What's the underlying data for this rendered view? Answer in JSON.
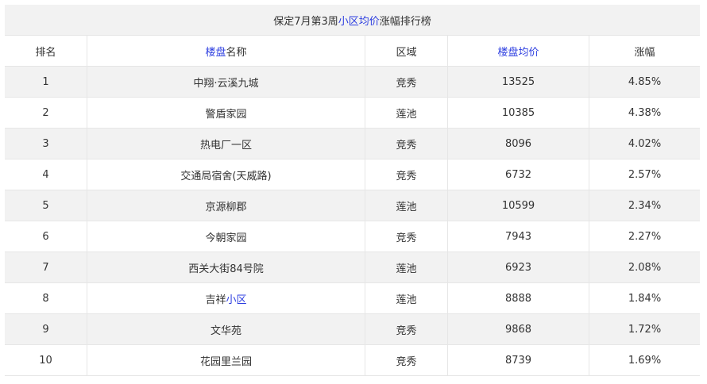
{
  "caption": {
    "pre": "保定7月第3周",
    "link": "小区均价",
    "post": "涨幅排行榜"
  },
  "headers": {
    "rank": "排名",
    "name_link": "楼盘",
    "name_rest": "名称",
    "district": "区域",
    "price": "楼盘均价",
    "change": "涨幅"
  },
  "rows": [
    {
      "rank": "1",
      "name": "中翔·云溪九城",
      "name_link": "",
      "district": "竞秀",
      "price": "13525",
      "change": "4.85%"
    },
    {
      "rank": "2",
      "name": "警盾家园",
      "name_link": "",
      "district": "莲池",
      "price": "10385",
      "change": "4.38%"
    },
    {
      "rank": "3",
      "name": "热电厂一区",
      "name_link": "",
      "district": "竞秀",
      "price": "8096",
      "change": "4.02%"
    },
    {
      "rank": "4",
      "name": "交通局宿舍(天威路)",
      "name_link": "",
      "district": "竞秀",
      "price": "6732",
      "change": "2.57%"
    },
    {
      "rank": "5",
      "name": "京源柳郡",
      "name_link": "",
      "district": "莲池",
      "price": "10599",
      "change": "2.34%"
    },
    {
      "rank": "6",
      "name": "今朝家园",
      "name_link": "",
      "district": "竞秀",
      "price": "7943",
      "change": "2.27%"
    },
    {
      "rank": "7",
      "name": "西关大街84号院",
      "name_link": "",
      "district": "莲池",
      "price": "6923",
      "change": "2.08%"
    },
    {
      "rank": "8",
      "name": "吉祥",
      "name_link": "小区",
      "district": "莲池",
      "price": "8888",
      "change": "1.84%"
    },
    {
      "rank": "9",
      "name": "文华苑",
      "name_link": "",
      "district": "竞秀",
      "price": "9868",
      "change": "1.72%"
    },
    {
      "rank": "10",
      "name": "花园里兰园",
      "name_link": "",
      "district": "竞秀",
      "price": "8739",
      "change": "1.69%"
    }
  ],
  "colors": {
    "link": "#2d3ee0",
    "stripe": "#f2f2f2",
    "border": "#e6e6e6"
  }
}
